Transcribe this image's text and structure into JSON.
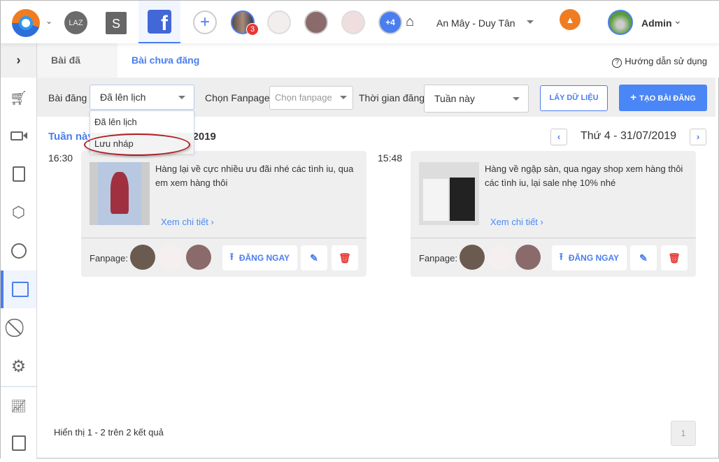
{
  "topbar": {
    "notification_count": "3",
    "more_pages": "+4",
    "store_name": "An Mây - Duy Tân",
    "user_name": "Admin",
    "lazada_label": "LAZ",
    "shopee_label": "S"
  },
  "tabs": [
    {
      "label": "Bài đã đăng"
    },
    {
      "label": "Bài chưa đăng",
      "active": true
    }
  ],
  "help_label": "Hướng dẫn sử dụng",
  "filter": {
    "post_label": "Bài đăng",
    "post_value": "Đã lên lịch",
    "fanpage_label": "Chọn Fanpage",
    "fanpage_placeholder": "Chọn fanpage",
    "time_label": "Thời gian đăng",
    "time_value": "Tuần này",
    "fetch_button": "LẤY DỮ LIỆU",
    "create_button": "TẠO BÀI ĐĂNG"
  },
  "dropdown": {
    "options": [
      "Đã lên lịch",
      "Lưu nháp"
    ]
  },
  "week_heading": "Tuần này",
  "week_heading_tail": "8/2019",
  "day_label": "Thứ 4 - 31/07/2019",
  "posts": [
    {
      "time": "16:30",
      "text": "Hàng lại về cực nhiều ưu đãi nhé các tình iu, qua em xem hàng thôi",
      "more": "Xem chi tiết",
      "fanpage_label": "Fanpage:",
      "post_now": "ĐĂNG NGAY"
    },
    {
      "time": "15:48",
      "text": "Hàng về ngập sàn, qua ngay shop xem hàng thôi các tình iu, lại sale nhẹ 10% nhé",
      "more": "Xem chi tiết",
      "fanpage_label": "Fanpage:",
      "post_now": "ĐĂNG NGAY"
    }
  ],
  "footer": {
    "summary": "Hiển thị 1 - 2 trên 2 kết quả",
    "page": "1"
  },
  "colors": {
    "accent": "#4a7ef0",
    "warning": "#f07c22",
    "danger": "#e53935"
  }
}
